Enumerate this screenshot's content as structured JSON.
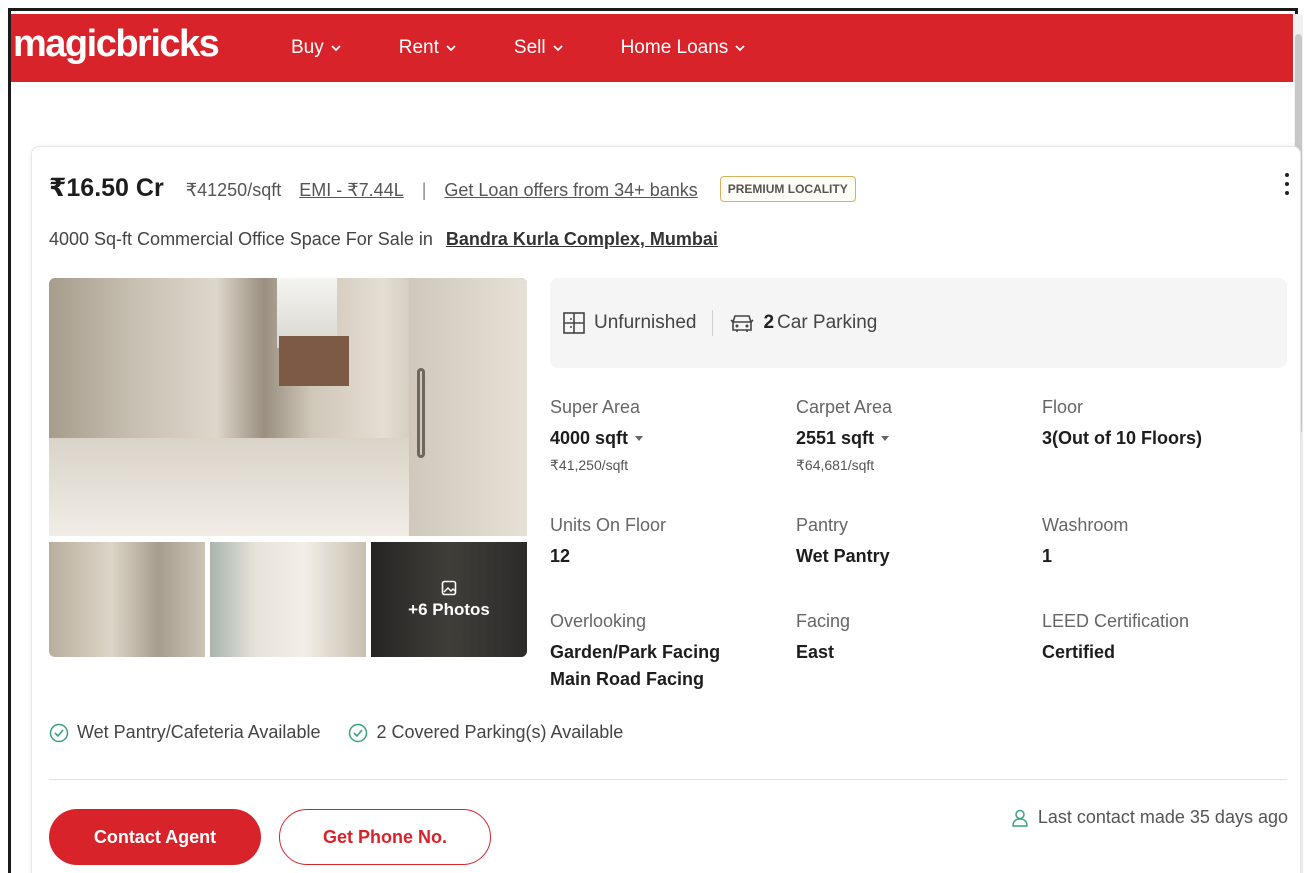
{
  "header": {
    "logo": "magicbricks",
    "nav": [
      {
        "label": "Buy"
      },
      {
        "label": "Rent"
      },
      {
        "label": "Sell"
      },
      {
        "label": "Home Loans"
      }
    ]
  },
  "listing": {
    "price": "₹16.50 Cr",
    "price_per_sqft": "₹41250/sqft",
    "emi": "EMI - ₹7.44L",
    "separator": "|",
    "loan_offer": "Get Loan offers from 34+ banks",
    "badge": "PREMIUM LOCALITY",
    "title": "4000 Sq-ft Commercial Office Space For Sale in",
    "location": "Bandra Kurla Complex, Mumbai",
    "more_photos": "+6 Photos",
    "amenities": {
      "furnishing": "Unfurnished",
      "parking_count": "2",
      "parking_label": "Car Parking"
    },
    "specs": {
      "super_area": {
        "label": "Super Area",
        "value": "4000 sqft",
        "sub": "₹41,250/sqft"
      },
      "carpet_area": {
        "label": "Carpet Area",
        "value": "2551 sqft",
        "sub": "₹64,681/sqft"
      },
      "floor": {
        "label": "Floor",
        "value": "3(Out of 10 Floors)"
      },
      "units_on_floor": {
        "label": "Units On Floor",
        "value": "12"
      },
      "pantry": {
        "label": "Pantry",
        "value": "Wet Pantry"
      },
      "washroom": {
        "label": "Washroom",
        "value": "1"
      },
      "overlooking": {
        "label": "Overlooking",
        "value1": "Garden/Park Facing",
        "value2": "Main Road Facing"
      },
      "facing": {
        "label": "Facing",
        "value": "East"
      },
      "leed": {
        "label": "LEED Certification",
        "value": "Certified"
      }
    },
    "features": [
      "Wet Pantry/Cafeteria Available",
      "2 Covered Parking(s) Available"
    ],
    "actions": {
      "contact": "Contact Agent",
      "phone": "Get Phone No."
    },
    "last_contact": "Last contact made 35 days ago"
  },
  "colors": {
    "brand": "#d8232a",
    "check": "#3aa17e",
    "badge_border": "#d6b25e"
  }
}
